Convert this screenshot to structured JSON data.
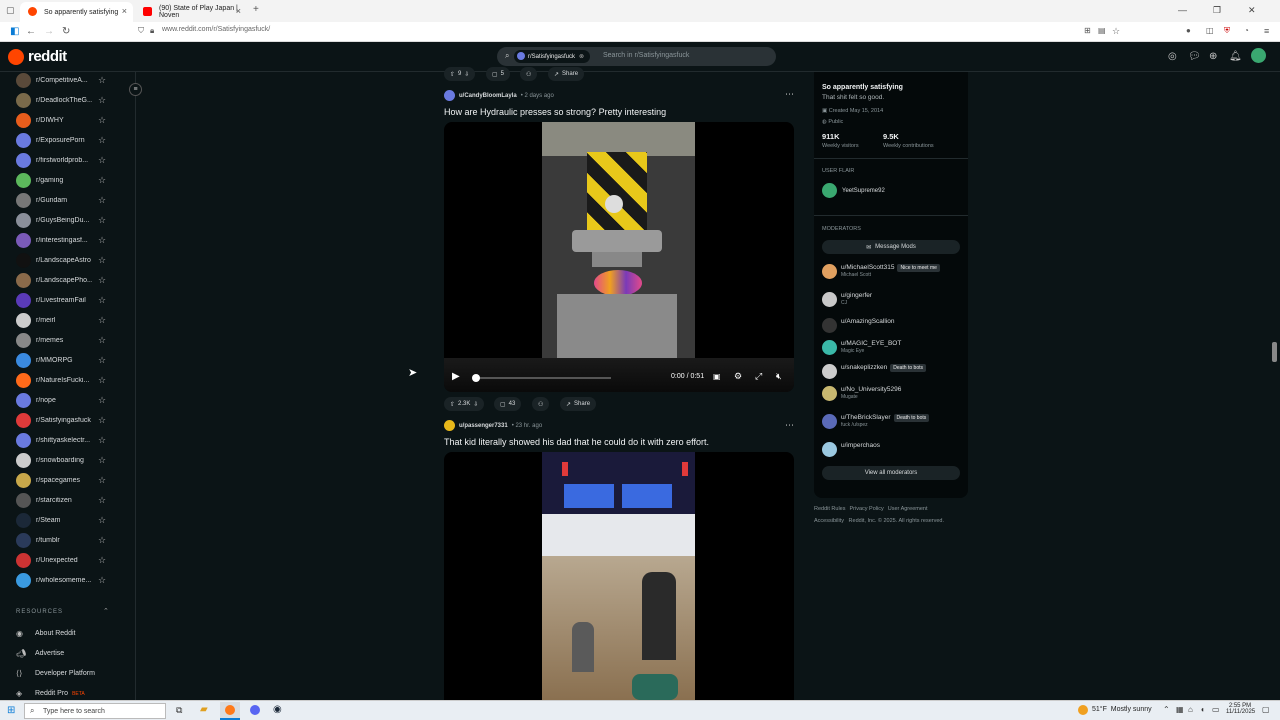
{
  "browser": {
    "tabs": [
      {
        "title": "So apparently satisfying",
        "active": true
      },
      {
        "title": "(90) State of Play Japan | Noven",
        "active": false
      }
    ],
    "url": "www.reddit.com/r/Satisfyingasfuck/",
    "new_tab": "+"
  },
  "header": {
    "logo_text": "reddit",
    "search_chip": "r/Satisfyingasfuck",
    "search_placeholder": "Search in r/Satisfyingasfuck"
  },
  "sidebar": {
    "items": [
      {
        "name": "r/CompetitiveA...",
        "color": "#5a4a3a"
      },
      {
        "name": "r/DeadlockTheG...",
        "color": "#7a6a4a"
      },
      {
        "name": "r/DIWHY",
        "color": "#e85d1c"
      },
      {
        "name": "r/ExposurePorn",
        "color": "#6a7ae0"
      },
      {
        "name": "r/firstworldprob...",
        "color": "#6a7ae0"
      },
      {
        "name": "r/gaming",
        "color": "#5cb85c"
      },
      {
        "name": "r/Gundam",
        "color": "#777777"
      },
      {
        "name": "r/GuysBeingDu...",
        "color": "#8a8f9a"
      },
      {
        "name": "r/interestingasf...",
        "color": "#7a5ab8"
      },
      {
        "name": "r/LandscapeAstro",
        "color": "#111111"
      },
      {
        "name": "r/LandscapePho...",
        "color": "#8a6a4a"
      },
      {
        "name": "r/LivestreamFail",
        "color": "#5a3ab8"
      },
      {
        "name": "r/meirl",
        "color": "#cccccc"
      },
      {
        "name": "r/memes",
        "color": "#888888"
      },
      {
        "name": "r/MMORPG",
        "color": "#3a8ae0"
      },
      {
        "name": "r/NatureIsFucki...",
        "color": "#ff6a1a"
      },
      {
        "name": "r/nope",
        "color": "#6a7ae0"
      },
      {
        "name": "r/Satisfyingasfuck",
        "color": "#e03a3a"
      },
      {
        "name": "r/shittyaskelectr...",
        "color": "#6a7ae0"
      },
      {
        "name": "r/snowboarding",
        "color": "#cccccc"
      },
      {
        "name": "r/spacegames",
        "color": "#c8a84a"
      },
      {
        "name": "r/starcitizen",
        "color": "#555555"
      },
      {
        "name": "r/Steam",
        "color": "#1b2838"
      },
      {
        "name": "r/tumblr",
        "color": "#2a3a5a"
      },
      {
        "name": "r/Unexpected",
        "color": "#cc3333"
      },
      {
        "name": "r/wholesomeme...",
        "color": "#3a9ae0"
      }
    ],
    "resources_title": "RESOURCES",
    "resources": [
      {
        "label": "About Reddit",
        "icon": "reddit-icon"
      },
      {
        "label": "Advertise",
        "icon": "megaphone-icon"
      },
      {
        "label": "Developer Platform",
        "icon": "code-icon"
      },
      {
        "label": "Reddit Pro",
        "badge": "BETA",
        "icon": "pro-icon"
      }
    ]
  },
  "feed": {
    "top_actions": {
      "votes": "9",
      "comments": "5",
      "share": "Share"
    },
    "post1": {
      "author": "u/CandyBloomLayla",
      "time": "• 2 days ago",
      "title": "How are Hydraulic presses so strong? Pretty interesting",
      "video_time": "0:00 / 0:51",
      "progress": 0,
      "votes": "2.3K",
      "comments": "43",
      "share": "Share"
    },
    "post2": {
      "author": "u/passenger7331",
      "time": "• 23 hr. ago",
      "title": "That kid literally showed his dad that he could do it with zero effort."
    }
  },
  "community": {
    "title": "So apparently satisfying",
    "description": "That shit felt so good.",
    "created": "Created May 15, 2014",
    "visibility": "Public",
    "visitors_value": "911K",
    "visitors_label": "Weekly visitors",
    "contrib_value": "9.5K",
    "contrib_label": "Weekly contributions",
    "user_flair_title": "USER FLAIR",
    "user_flair_name": "YeetSupreme92",
    "moderators_title": "MODERATORS",
    "message_mods": "Message Mods",
    "mods": [
      {
        "name": "u/MichaelScott315",
        "flair": "Nice to meet me",
        "sub": "Michael Scott",
        "color": "#e0a060"
      },
      {
        "name": "u/gingerfer",
        "flair": "",
        "sub": "CJ",
        "color": "#c8c8c8"
      },
      {
        "name": "u/AmazingScallion",
        "flair": "",
        "sub": "",
        "color": "#333333"
      },
      {
        "name": "u/MAGIC_EYE_BOT",
        "flair": "",
        "sub": "Magic Eye",
        "color": "#3ab8a8"
      },
      {
        "name": "u/snakeplizzken",
        "flair": "Death to bots",
        "sub": "",
        "color": "#cccccc"
      },
      {
        "name": "u/No_University5296",
        "flair": "",
        "sub": "Mugate",
        "color": "#c8b870"
      },
      {
        "name": "u/TheBrickSlayer",
        "flair": "Death to bots",
        "sub": "fuck /u/spez",
        "color": "#5a6ab8"
      },
      {
        "name": "u/imperchaos",
        "flair": "",
        "sub": "",
        "color": "#9ac8e0"
      }
    ],
    "view_all": "View all moderators",
    "footer_links": [
      "Reddit Rules",
      "Privacy Policy",
      "User Agreement"
    ],
    "footer_line2": "Accessibility   Reddit, Inc. © 2025. All rights reserved."
  },
  "taskbar": {
    "search_placeholder": "Type here to search",
    "weather": "51°F  Mostly sunny",
    "time": "2:55 PM",
    "date": "11/11/2025"
  }
}
